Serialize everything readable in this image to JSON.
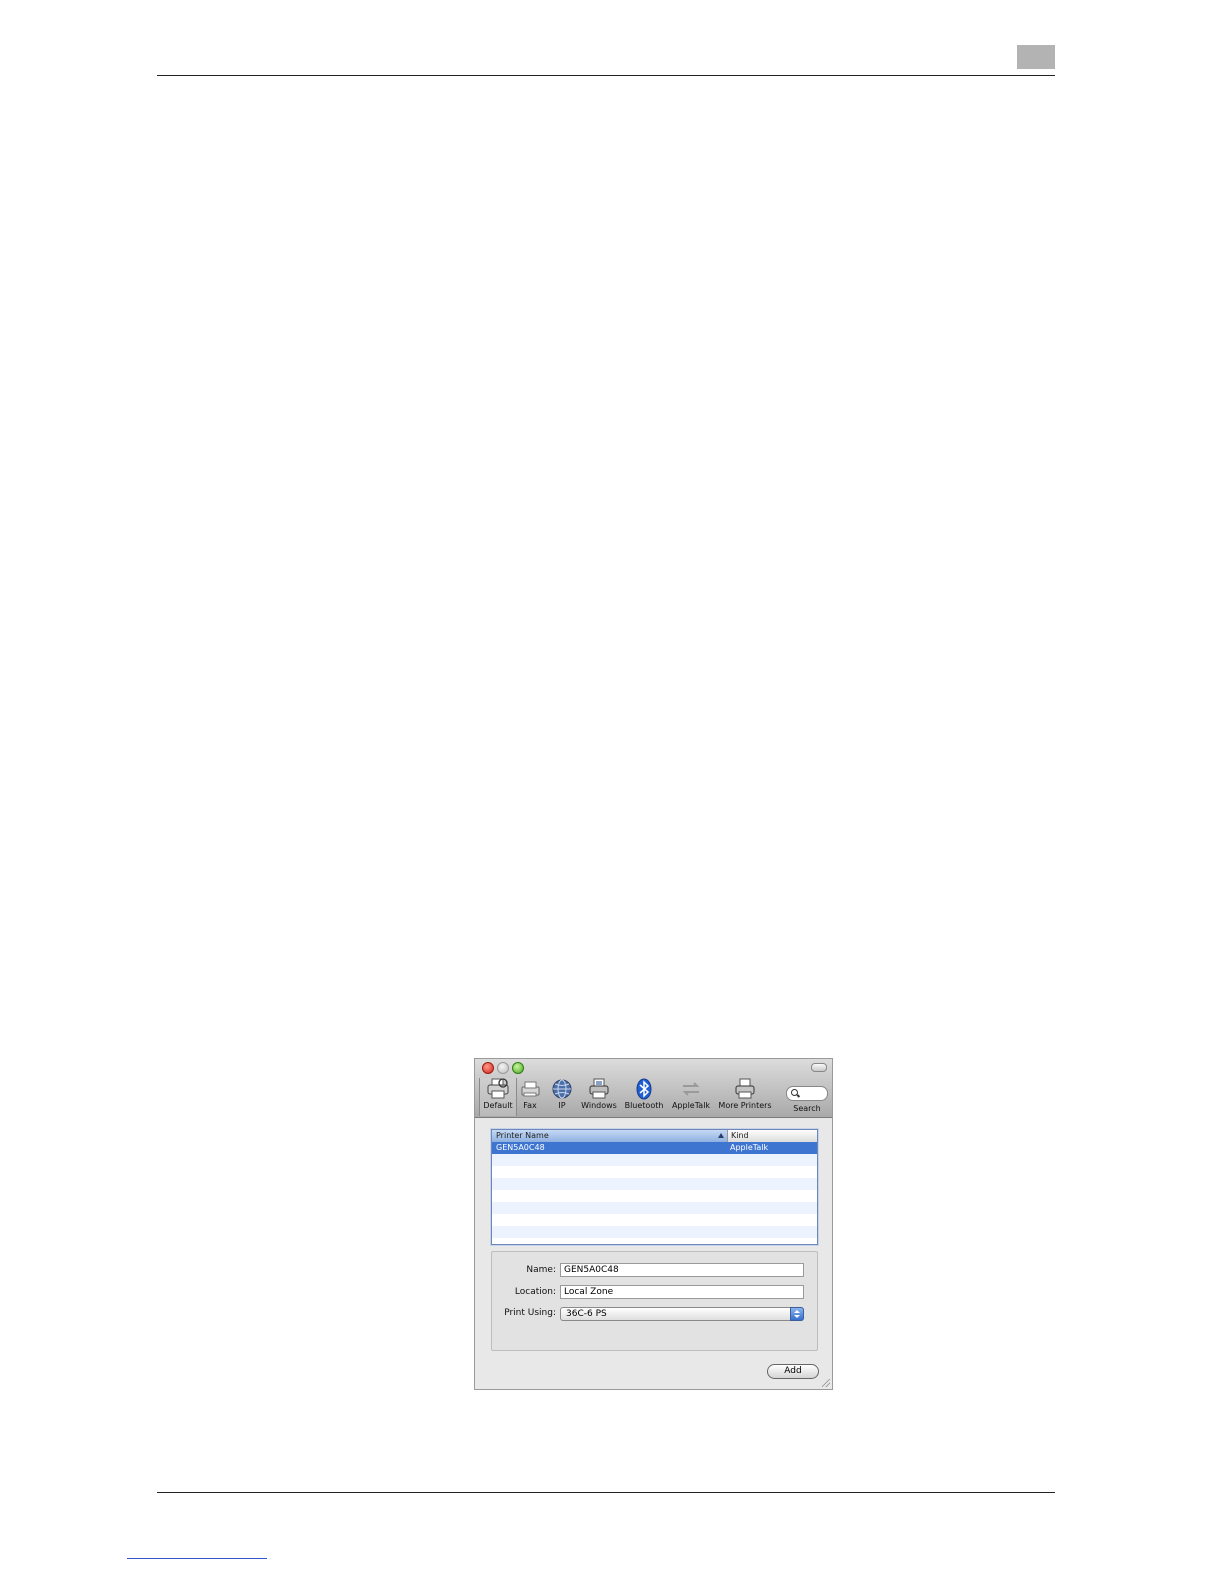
{
  "toolbar": {
    "items": [
      {
        "label": "Default",
        "icon": "printer-default-icon"
      },
      {
        "label": "Fax",
        "icon": "fax-icon"
      },
      {
        "label": "IP",
        "icon": "globe-icon"
      },
      {
        "label": "Windows",
        "icon": "windows-printer-icon"
      },
      {
        "label": "Bluetooth",
        "icon": "bluetooth-icon"
      },
      {
        "label": "AppleTalk",
        "icon": "appletalk-icon"
      },
      {
        "label": "More Printers",
        "icon": "more-printers-icon"
      },
      {
        "label": "Search",
        "icon": "search-icon"
      }
    ],
    "selected": "Default"
  },
  "printer_list": {
    "columns": {
      "name": "Printer Name",
      "kind": "Kind"
    },
    "rows": [
      {
        "name": "GEN5A0C48",
        "kind": "AppleTalk",
        "selected": true
      }
    ]
  },
  "form": {
    "name_label": "Name:",
    "name_value": "GEN5A0C48",
    "location_label": "Location:",
    "location_value": "Local Zone",
    "print_using_label": "Print Using:",
    "print_using_value": "36C-6 PS"
  },
  "buttons": {
    "add": "Add"
  },
  "colors": {
    "selection": "#3d75d1",
    "close": "#d0241a",
    "zoom": "#4aa823"
  }
}
